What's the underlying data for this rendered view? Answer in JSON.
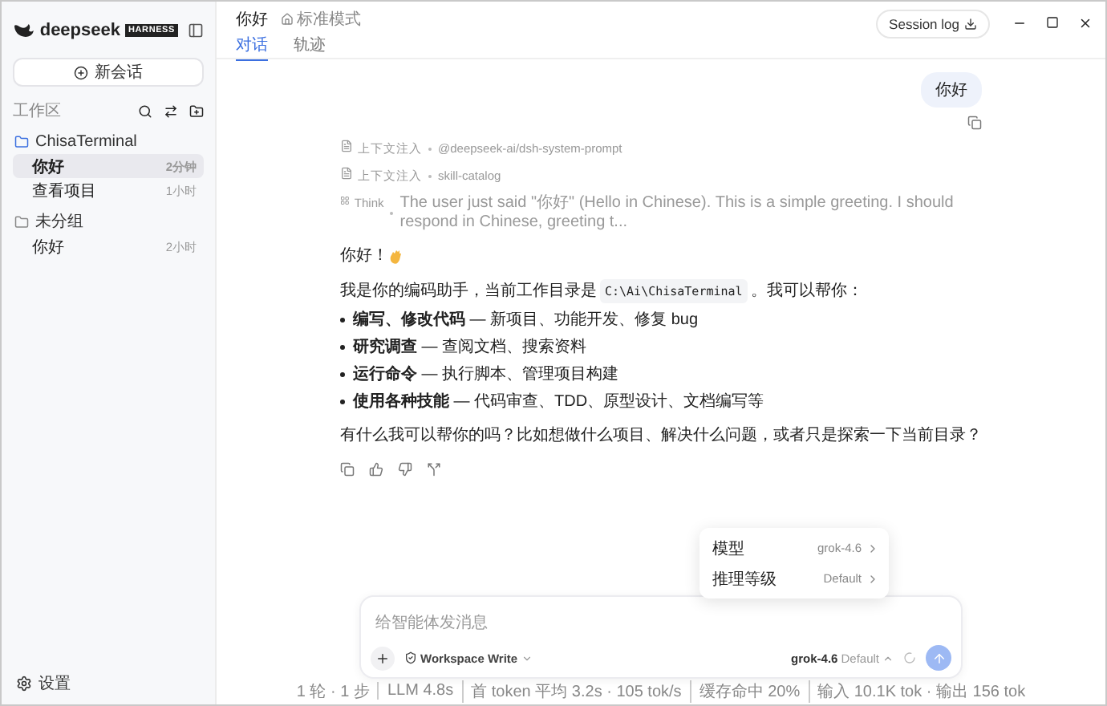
{
  "sidebar": {
    "brand": "deepseek",
    "badge": "HARNESS",
    "new_chat": "新会话",
    "section_label": "工作区",
    "groups": [
      {
        "kind": "project",
        "name": "ChisaTerminal",
        "children": [
          {
            "title": "你好",
            "time": "2分钟",
            "selected": true
          },
          {
            "title": "查看项目",
            "time": "1小时",
            "selected": false
          }
        ]
      },
      {
        "kind": "ungrouped",
        "name": "未分组",
        "children": [
          {
            "title": "你好",
            "time": "2小时",
            "selected": false
          }
        ]
      }
    ],
    "settings": "设置"
  },
  "header": {
    "title": "你好",
    "mode": "标准模式",
    "tabs": [
      {
        "label": "对话",
        "selected": true
      },
      {
        "label": "轨迹",
        "selected": false
      }
    ],
    "session_log": "Session log"
  },
  "chat": {
    "user_message": "你好",
    "events": [
      {
        "kind": "inject",
        "label": "上下文注入",
        "detail": "@deepseek-ai/dsh-system-prompt"
      },
      {
        "kind": "inject",
        "label": "上下文注入",
        "detail": "skill-catalog"
      },
      {
        "kind": "think",
        "label": "Think",
        "detail": "The user just said \"你好\" (Hello in Chinese). This is a simple greeting. I should respond in Chinese, greeting t..."
      }
    ],
    "reply": {
      "greeting": "你好！",
      "intro_before": "我是你的编码助手，当前工作目录是",
      "path": "C:\\Ai\\ChisaTerminal",
      "intro_after": "。我可以帮你：",
      "bullets": [
        "**编写、修改代码** — 新项目、功能开发、修复 bug",
        "**研究调查** — 查阅文档、搜索资料",
        "**运行命令** — 执行脚本、管理项目构建",
        "**使用各种技能** — 代码审查、TDD、原型设计、文档编写等"
      ],
      "closing": "有什么我可以帮你的吗？比如想做什么项目、解决什么问题，或者只是探索一下当前目录？"
    }
  },
  "model_menu": [
    {
      "label": "模型",
      "value": "grok-4.6"
    },
    {
      "label": "推理等级",
      "value": "Default"
    }
  ],
  "composer": {
    "placeholder": "给智能体发消息",
    "permission": "Workspace Write",
    "model": "grok-4.6",
    "effort": "Default"
  },
  "status_bar": [
    "1 轮 · 1 步",
    "LLM 4.8s",
    "首 token 平均 3.2s · 105 tok/s",
    "缓存命中 20%",
    "输入 10.1K tok · 输出 156 tok"
  ]
}
